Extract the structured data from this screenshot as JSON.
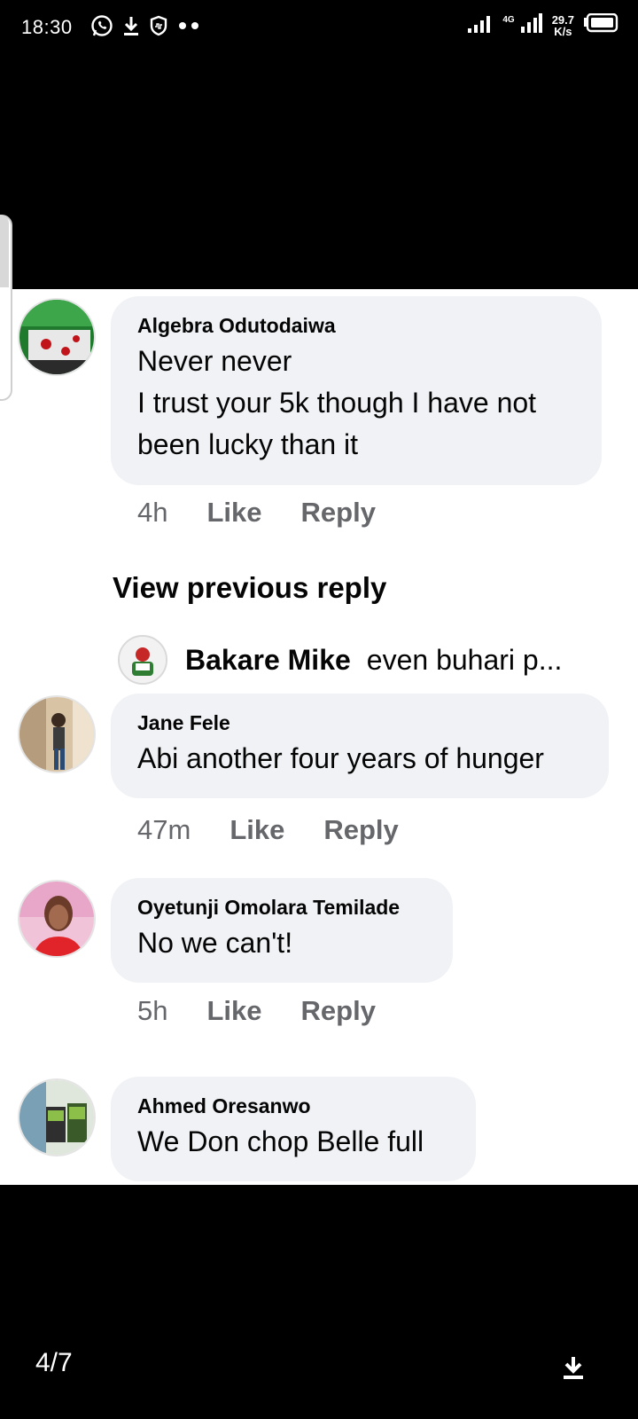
{
  "status_bar": {
    "time": "18:30",
    "network": "4G",
    "speed_value": "29.7",
    "speed_unit": "K/s"
  },
  "viewer": {
    "page_indicator": "4/7",
    "download_icon": "download-icon"
  },
  "comments": [
    {
      "name": "Algebra Odutodaiwa",
      "text": "Never never\nI trust your 5k though I have not\nbeen lucky than it",
      "time": "4h",
      "like_label": "Like",
      "reply_label": "Reply"
    },
    {
      "name": "Jane Fele",
      "text": "Abi another four years of hunger",
      "time": "47m",
      "like_label": "Like",
      "reply_label": "Reply"
    },
    {
      "name": "Oyetunji Omolara Temilade",
      "text": "No we can't!",
      "time": "5h",
      "like_label": "Like",
      "reply_label": "Reply"
    },
    {
      "name": "Ahmed Oresanwo",
      "text": "We Don chop Belle full"
    }
  ],
  "view_previous": "View previous reply",
  "reply_preview": {
    "name": "Bakare Mike",
    "snippet": "even buhari p..."
  }
}
